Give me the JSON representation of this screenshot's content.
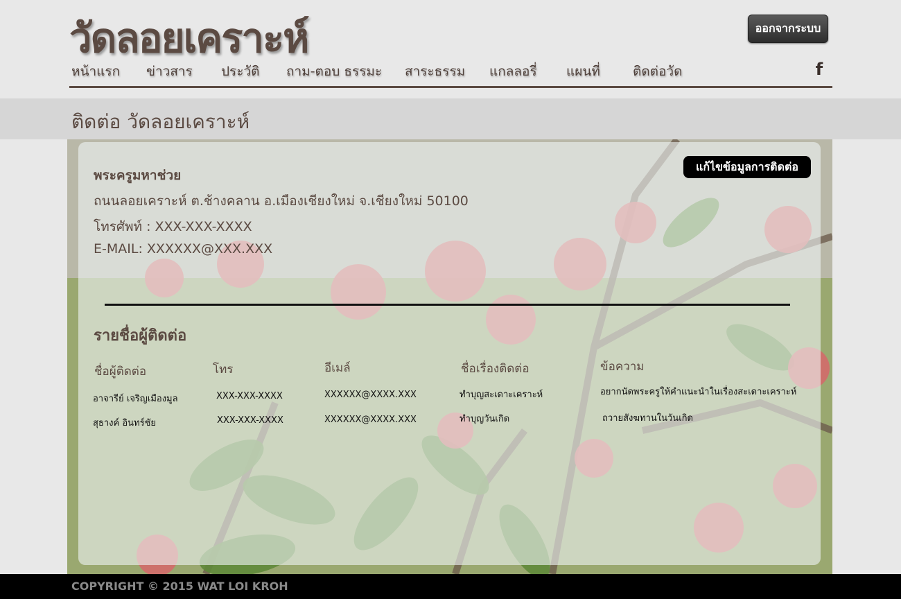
{
  "header": {
    "site_title": "วัดลอยเคราะห์",
    "logout_label": "ออกจากระบบ",
    "facebook_icon": "facebook-icon"
  },
  "nav": {
    "items": [
      {
        "label": "หน้าแรก"
      },
      {
        "label": "ข่าวสาร"
      },
      {
        "label": "ประวัติ"
      },
      {
        "label": "ถาม-ตอบ ธรรมะ"
      },
      {
        "label": "สาระธรรม"
      },
      {
        "label": "แกลลอรี่"
      },
      {
        "label": "แผนที่"
      },
      {
        "label": "ติดต่อวัด"
      }
    ]
  },
  "page": {
    "title": "ติดต่อ วัดลอยเคราะห์"
  },
  "contact": {
    "edit_label": "แก้ไขข้อมูลการติดต่อ",
    "name": "พระครูมหาช่วย",
    "address": "ถนนลอยเคราะห์ ต.ช้างคลาน อ.เมืองเชียงใหม่ จ.เชียงใหม่ 50100",
    "phone": "โทรศัพท์ : XXX-XXX-XXXX",
    "email": "E-MAIL: XXXXXX@XXX.XXX"
  },
  "contact_list": {
    "title": "รายชื่อผู้ติดต่อ",
    "columns": [
      "ชื่อผู้ติดต่อ",
      "โทร",
      "อีเมล์",
      "ชื่อเรื่องติดต่อ",
      "ข้อความ"
    ],
    "rows": [
      [
        "อาจารีย์ เจริญเมืองมูล",
        "XXX-XXX-XXXX",
        "XXXXXX@XXXX.XXX",
        "ทำบุญสะเดาะเคราะห์",
        "อยากนัดพระครูให้คำแนะนำในเรื่องสะเดาะเคราะห์"
      ],
      [
        "สุธางค์ อินทร์ชัย",
        "XXX-XXX-XXXX",
        "XXXXXX@XXXX.XXX",
        "ทำบุญวันเกิด",
        "ถวายสังฆทานในวันเกิด"
      ]
    ]
  },
  "footer": {
    "copyright": "COPYRIGHT © 2015 WAT LOI KROH"
  },
  "colors": {
    "brand_brown": "#5b4a42",
    "background": "#e8e8e8",
    "band": "#d6d6d6",
    "footer": "#000000"
  }
}
